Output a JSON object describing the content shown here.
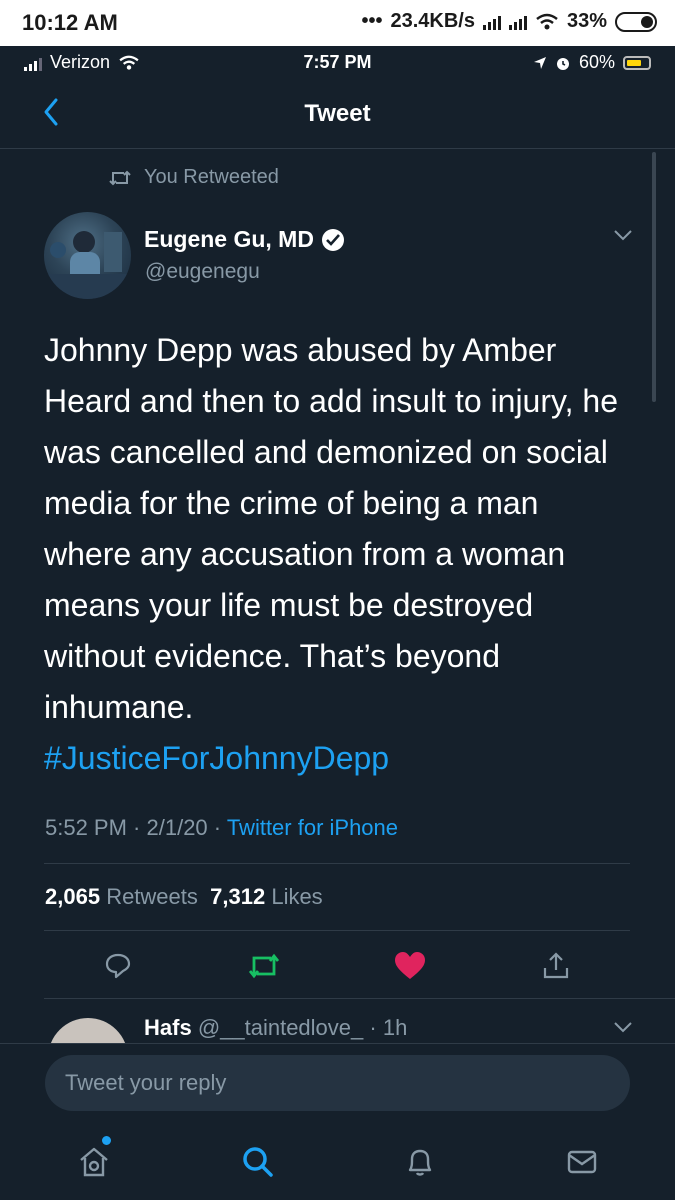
{
  "android_status": {
    "time": "10:12 AM",
    "speed": "23.4KB/s",
    "battery": "33%"
  },
  "ios_status": {
    "carrier": "Verizon",
    "time": "7:57 PM",
    "battery": "60%"
  },
  "nav": {
    "title": "Tweet"
  },
  "tweet": {
    "retweet_label": "You Retweeted",
    "author_name": "Eugene Gu, MD",
    "author_handle": "@eugenegu",
    "text": "Johnny Depp was abused by Amber Heard and then to add insult to injury, he was cancelled and demonized on social media for the crime of being a man where any accusation from a woman means your life must be destroyed without evidence. That’s beyond inhumane.",
    "hashtag": "#JusticeForJohnnyDepp",
    "time": "5:52 PM",
    "date": "2/1/20",
    "source": "Twitter for iPhone",
    "retweets_count": "2,065",
    "retweets_label": "Retweets",
    "likes_count": "7,312",
    "likes_label": "Likes"
  },
  "reply_preview": {
    "name": "Hafs",
    "handle": "@__taintedlove_",
    "age": "1h"
  },
  "compose": {
    "placeholder": "Tweet your reply"
  },
  "colors": {
    "background": "#15202b",
    "accent": "#1da1f2",
    "retweet": "#17bf63",
    "like": "#e0245e"
  }
}
